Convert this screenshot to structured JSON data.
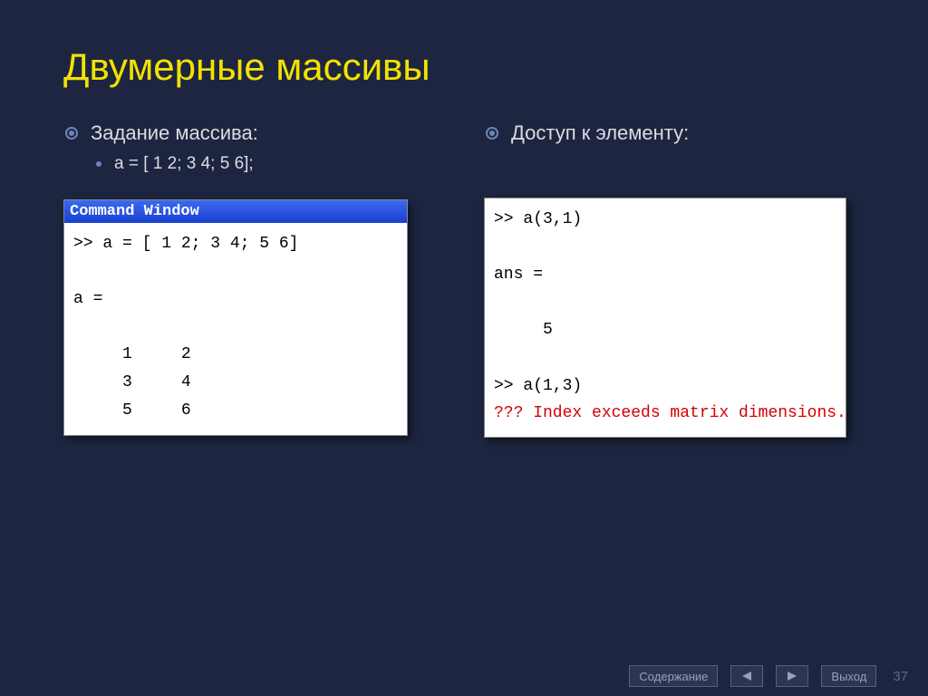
{
  "title": "Двумерные массивы",
  "left": {
    "heading": "Задание массива:",
    "sub": "а = [ 1 2; 3 4; 5 6];",
    "window_title": "Command Window",
    "code": ">> a = [ 1 2; 3 4; 5 6]\n\na =\n\n     1     2\n     3     4\n     5     6"
  },
  "right": {
    "heading": "Доступ к элементу:",
    "code_black": ">> a(3,1)\n\nans =\n\n     5\n\n>> a(1,3)",
    "code_error": "??? Index exceeds matrix dimensions."
  },
  "footer": {
    "contents": "Содержание",
    "exit": "Выход",
    "page": "37"
  }
}
